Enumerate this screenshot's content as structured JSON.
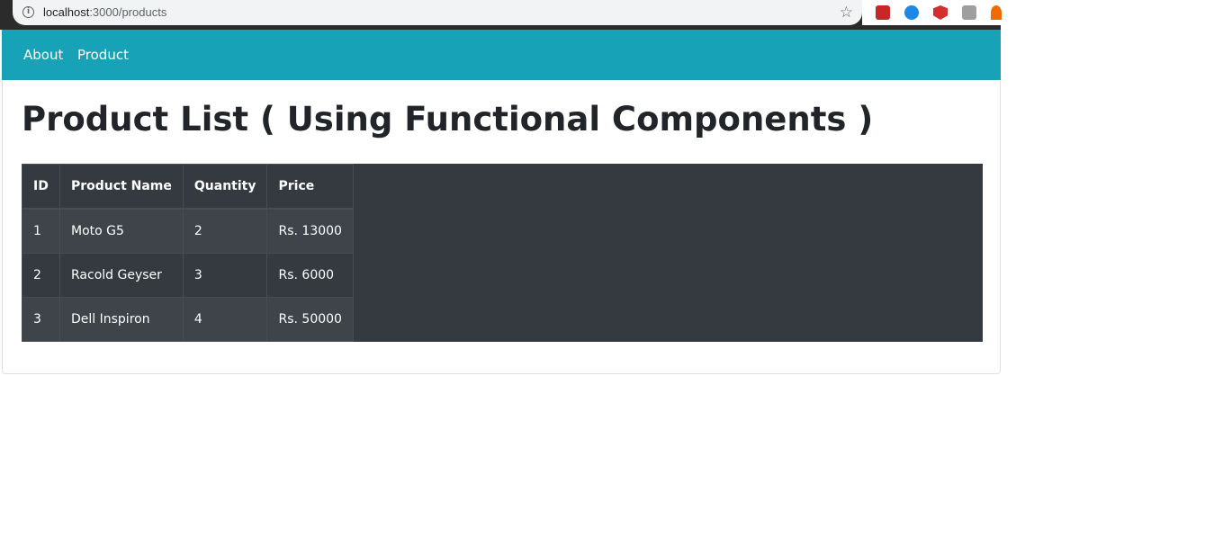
{
  "browser": {
    "url_host": "localhost",
    "url_path": ":3000/products"
  },
  "nav": {
    "items": [
      {
        "label": "About"
      },
      {
        "label": "Product"
      }
    ]
  },
  "page": {
    "title": "Product List ( Using Functional Components )"
  },
  "table": {
    "headers": [
      "ID",
      "Product Name",
      "Quantity",
      "Price"
    ],
    "rows": [
      [
        "1",
        "Moto G5",
        "2",
        "Rs. 13000"
      ],
      [
        "2",
        "Racold Geyser",
        "3",
        "Rs. 6000"
      ],
      [
        "3",
        "Dell Inspiron",
        "4",
        "Rs. 50000"
      ]
    ]
  },
  "colors": {
    "navbar": "#17a2b8",
    "table_bg": "#343a40",
    "title": "#212529"
  },
  "icons": [
    "info-icon",
    "star-icon",
    "extension-icon"
  ]
}
